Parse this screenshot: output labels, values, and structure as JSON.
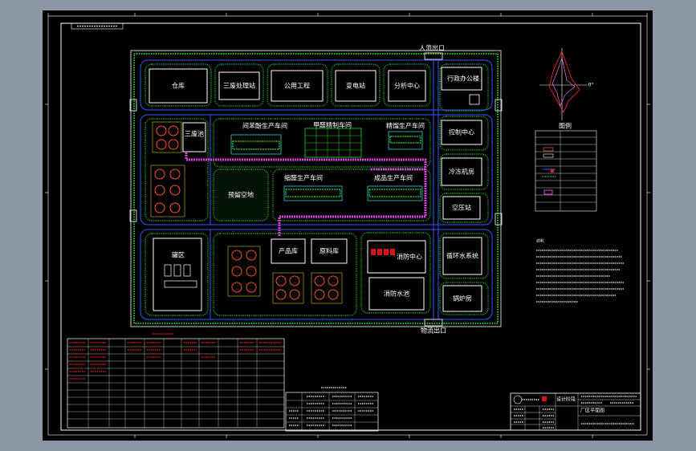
{
  "site": {
    "buildings": [
      "仓库",
      "三废处理站",
      "公用工程",
      "变电站",
      "分析中心",
      "行政办公楼",
      "控制中心",
      "冷冻机房",
      "空压站",
      "循环水系统",
      "锅炉房",
      "罐区",
      "产品库",
      "原料库",
      "消防中心",
      "消防水池",
      "三废池",
      "预留空地",
      "间苯酚生产车间",
      "甲醛精制车间",
      "精馏生产车间",
      "缩醛生产车间",
      "成品生产车间"
    ],
    "gates": [
      "人流出口",
      "物流出口"
    ]
  },
  "compass": {
    "east_label": "0°"
  },
  "legend": {
    "title": "图例"
  },
  "notes": {
    "title": "说明："
  },
  "title_block": {
    "label": "设计阶段",
    "drawing_name": "厂区平面图"
  },
  "colors": {
    "background": "#000000",
    "roads": "#2d5cff",
    "greenery": "#18c418",
    "pipe_rack": "#e040e0",
    "tanks": "#ff5522",
    "buildings": "#ffffff",
    "viewer_frame": "#8c97a6"
  }
}
